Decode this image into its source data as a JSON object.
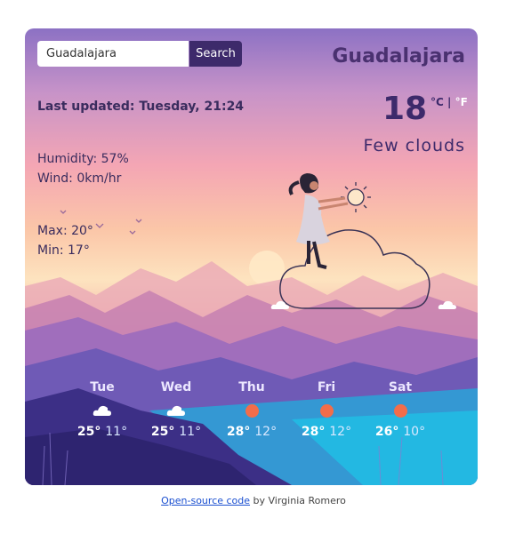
{
  "search": {
    "value": "Guadalajara",
    "button_label": "Search"
  },
  "current": {
    "city": "Guadalajara",
    "last_updated": "Last updated: Tuesday, 21:24",
    "temperature": "18",
    "unit_c": "°C",
    "unit_separator": " | ",
    "unit_f": "°F",
    "description": "Few clouds",
    "humidity": "Humidity: 57%",
    "wind": "Wind: 0km/hr",
    "max": "Max: 20°",
    "min": "Min: 17°"
  },
  "forecast": [
    {
      "day": "Tue",
      "icon": "cloud-icon",
      "max": "25°",
      "min": "11°"
    },
    {
      "day": "Wed",
      "icon": "cloud-icon",
      "max": "25°",
      "min": "11°"
    },
    {
      "day": "Thu",
      "icon": "sun-icon",
      "max": "28°",
      "min": "12°"
    },
    {
      "day": "Fri",
      "icon": "sun-icon",
      "max": "28°",
      "min": "12°"
    },
    {
      "day": "Sat",
      "icon": "sun-icon",
      "max": "26°",
      "min": "10°"
    }
  ],
  "footer": {
    "link_text": "Open-source code",
    "rest": " by Virginia Romero"
  },
  "colors": {
    "accent": "#3d2a6b",
    "sun": "#f26d4a"
  }
}
